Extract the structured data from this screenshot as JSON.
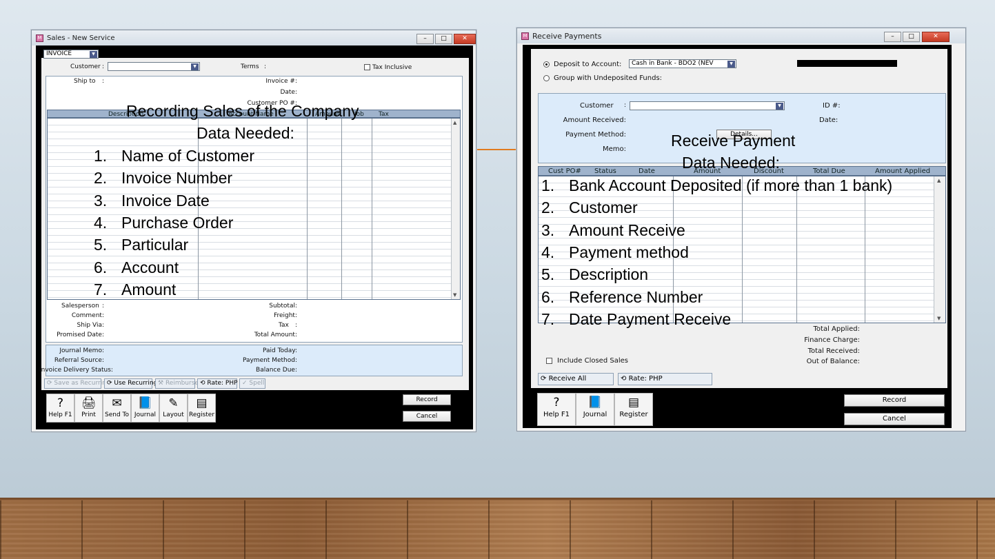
{
  "sales_window": {
    "title": "Sales - New Service",
    "form_type": "INVOICE",
    "labels": {
      "customer": "Customer",
      "colon": ":",
      "terms": "Terms",
      "tax_inclusive": "Tax Inclusive",
      "ship_to": "Ship to",
      "invoice_no": "Invoice #:",
      "date": "Date:",
      "customer_po": "Customer PO #:",
      "salesperson": "Salesperson",
      "comment": "Comment:",
      "ship_via": "Ship Via:",
      "promised_date": "Promised Date:",
      "subtotal": "Subtotal:",
      "freight": "Freight:",
      "tax": "Tax",
      "total_amount": "Total Amount:",
      "journal_memo": "Journal Memo:",
      "referral_source": "Referral Source:",
      "invoice_delivery_status": "Invoice Delivery Status:",
      "paid_today": "Paid Today:",
      "payment_method": "Payment Method:",
      "balance_due": "Balance Due:"
    },
    "columns": [
      "Description",
      "Account Name",
      "Amount",
      "Job",
      "Tax"
    ],
    "toolbar_buttons": [
      "Save as Recurring",
      "Use Recurring",
      "Reimburse",
      "Rate:  PHP",
      "Spell"
    ],
    "tools": [
      {
        "label": "Help F1",
        "icon": "?"
      },
      {
        "label": "Print",
        "icon": "🖨"
      },
      {
        "label": "Send To",
        "icon": "✉"
      },
      {
        "label": "Journal",
        "icon": "📘"
      },
      {
        "label": "Layout",
        "icon": "✎"
      },
      {
        "label": "Register",
        "icon": "▤"
      }
    ],
    "record_label": "Record",
    "cancel_label": "Cancel"
  },
  "payments_window": {
    "title": "Receive Payments",
    "deposit_to_label": "Deposit to Account:",
    "deposit_account": "Cash in Bank - BDO2  (NEV",
    "group_undeposited_label": "Group with Undeposited Funds:",
    "labels": {
      "customer": "Customer",
      "colon": ":",
      "id": "ID #:",
      "amount_received": "Amount Received:",
      "date": "Date:",
      "payment_method": "Payment Method:",
      "details": "Details...",
      "memo": "Memo:",
      "total_applied": "Total Applied:",
      "finance_charge": "Finance Charge:",
      "total_received": "Total Received:",
      "out_of_balance": "Out of Balance:",
      "include_closed_sales": "Include Closed Sales"
    },
    "columns": [
      "Cust PO#",
      "Status",
      "Date",
      "Amount",
      "Discount",
      "Total Due",
      "Amount Applied"
    ],
    "receive_all_label": "Receive All",
    "rate_label": "Rate:  PHP",
    "tools": [
      {
        "label": "Help F1",
        "icon": "?"
      },
      {
        "label": "Journal",
        "icon": "📘"
      },
      {
        "label": "Register",
        "icon": "▤"
      }
    ],
    "record_label": "Record",
    "cancel_label": "Cancel"
  },
  "overlay_left": {
    "title": "Recording Sales of the Company",
    "subtitle": "Data Needed:",
    "items": [
      {
        "num": "1.",
        "text": "Name of Customer"
      },
      {
        "num": "2.",
        "text": "Invoice Number"
      },
      {
        "num": "3.",
        "text": "Invoice Date"
      },
      {
        "num": "4.",
        "text": "Purchase Order"
      },
      {
        "num": "5.",
        "text": "Particular"
      },
      {
        "num": "6.",
        "text": "Account"
      },
      {
        "num": "7.",
        "text": "Amount"
      }
    ]
  },
  "overlay_right": {
    "title": "Receive Payment",
    "subtitle": "Data Needed:",
    "items": [
      {
        "num": "1.",
        "text": "Bank Account Deposited (if more than 1 bank)"
      },
      {
        "num": "2.",
        "text": "Customer"
      },
      {
        "num": "3.",
        "text": "Amount Receive"
      },
      {
        "num": "4.",
        "text": "Payment method"
      },
      {
        "num": "5.",
        "text": "Description"
      },
      {
        "num": "6.",
        "text": "Reference Number"
      },
      {
        "num": "7.",
        "text": "Date Payment Receive"
      }
    ]
  },
  "colors": {
    "accent_connector": "#e07a1f",
    "header_blue": "#9fb3cc",
    "panel_blue": "#dcebfa"
  }
}
